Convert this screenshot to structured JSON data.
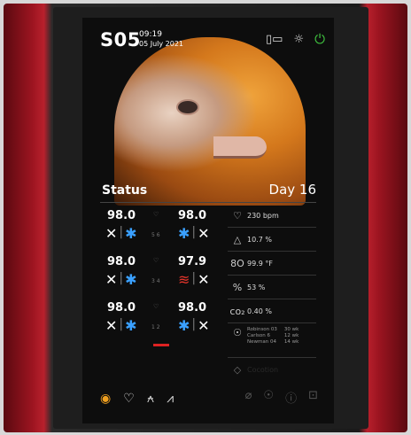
{
  "header": {
    "id": "S05",
    "time": "09:19",
    "date": "05 July 2021"
  },
  "status": {
    "title": "Status",
    "day": "Day 16"
  },
  "trays": [
    {
      "left": "98.0",
      "right": "98.0",
      "nums": "5 6"
    },
    {
      "left": "98.0",
      "right": "97.9",
      "nums": "3 4"
    },
    {
      "left": "98.0",
      "right": "98.0",
      "nums": "1 2"
    }
  ],
  "sensors": {
    "heart": "230 bpm",
    "o2": "10.7 %",
    "temp": "99.9 °F",
    "humidity": "53 %",
    "co2": "0.40 %",
    "staff_names": "Robinson 03\nCarlson 6\nNewman 04",
    "staff_ages": "30 wk\n12 wk\n14 wk",
    "faded": "Cocotion"
  },
  "colors": {
    "accent": "#f0a020",
    "power": "#3fc23f",
    "cool": "#3aa0ff",
    "heat": "#e8352b",
    "frame": "#b8202c"
  }
}
